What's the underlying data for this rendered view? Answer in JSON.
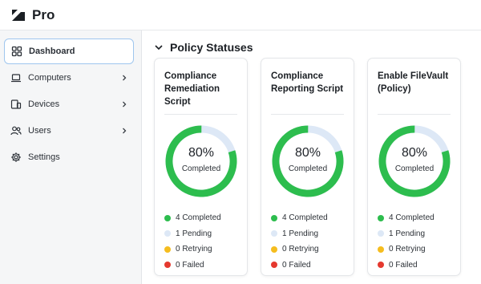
{
  "app": {
    "title": "Pro",
    "logo_icon": "jamf-logo-icon"
  },
  "sidebar": {
    "items": [
      {
        "label": "Dashboard",
        "icon": "dashboard-icon",
        "active": true,
        "has_chevron": false
      },
      {
        "label": "Computers",
        "icon": "laptop-icon",
        "active": false,
        "has_chevron": true
      },
      {
        "label": "Devices",
        "icon": "devices-icon",
        "active": false,
        "has_chevron": true
      },
      {
        "label": "Users",
        "icon": "users-icon",
        "active": false,
        "has_chevron": true
      },
      {
        "label": "Settings",
        "icon": "gear-icon",
        "active": false,
        "has_chevron": false
      }
    ]
  },
  "main": {
    "section_title": "Policy Statuses",
    "cards": [
      {
        "title": "Compliance Remediation Script",
        "percent_label": "80%",
        "completed_label": "Completed",
        "completed_fraction": 0.8,
        "legend": [
          "4 Completed",
          "1 Pending",
          "0 Retrying",
          "0 Failed"
        ]
      },
      {
        "title": "Compliance Reporting Script",
        "percent_label": "80%",
        "completed_label": "Completed",
        "completed_fraction": 0.8,
        "legend": [
          "4 Completed",
          "1 Pending",
          "0 Retrying",
          "0 Failed"
        ]
      },
      {
        "title": "Enable FileVault (Policy)",
        "percent_label": "80%",
        "completed_label": "Completed",
        "completed_fraction": 0.8,
        "legend": [
          "4 Completed",
          "1 Pending",
          "0 Retrying",
          "0 Failed"
        ]
      }
    ]
  },
  "colors": {
    "completed": "#2dbd4e",
    "pending": "#dde8f6",
    "retrying": "#f5bd1f",
    "failed": "#e5392f",
    "active_border": "#9fc6ee"
  }
}
